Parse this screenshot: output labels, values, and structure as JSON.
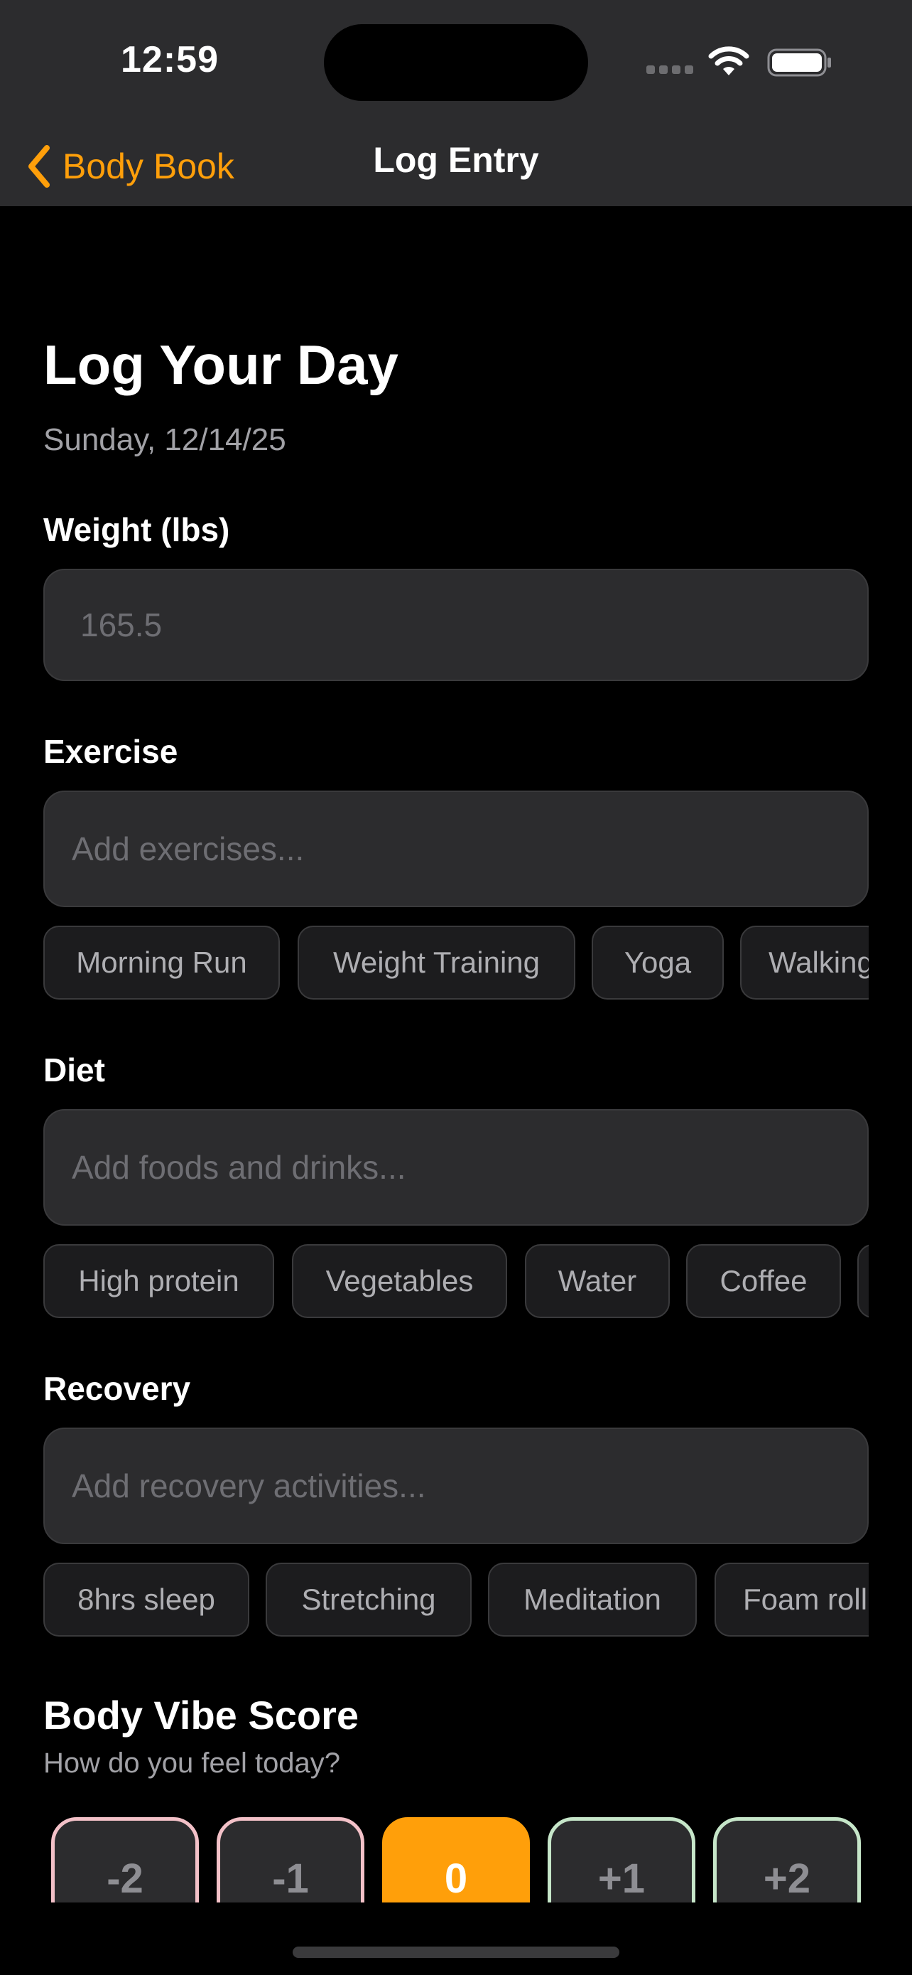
{
  "status_bar": {
    "time": "12:59"
  },
  "nav": {
    "back_label": "Body Book",
    "title": "Log Entry"
  },
  "page": {
    "title": "Log Your Day",
    "date": "Sunday, 12/14/25"
  },
  "weight": {
    "label": "Weight (lbs)",
    "placeholder": "165.5",
    "value": ""
  },
  "exercise": {
    "label": "Exercise",
    "placeholder": "Add exercises...",
    "chips": [
      "Morning Run",
      "Weight Training",
      "Yoga",
      "Walking"
    ]
  },
  "diet": {
    "label": "Diet",
    "placeholder": "Add foods and drinks...",
    "chips": [
      "High protein",
      "Vegetables",
      "Water",
      "Coffee",
      ""
    ]
  },
  "recovery": {
    "label": "Recovery",
    "placeholder": "Add recovery activities...",
    "chips": [
      "8hrs sleep",
      "Stretching",
      "Meditation",
      "Foam rolling"
    ]
  },
  "vibe": {
    "title": "Body Vibe Score",
    "subtitle": "How do you feel today?",
    "options": [
      "-2",
      "-1",
      "0",
      "+1",
      "+2"
    ],
    "selected": "0"
  },
  "colors": {
    "accent": "#ff9f0a",
    "negative_border": "#f3c1c8",
    "positive_border": "#c6e6c9"
  }
}
